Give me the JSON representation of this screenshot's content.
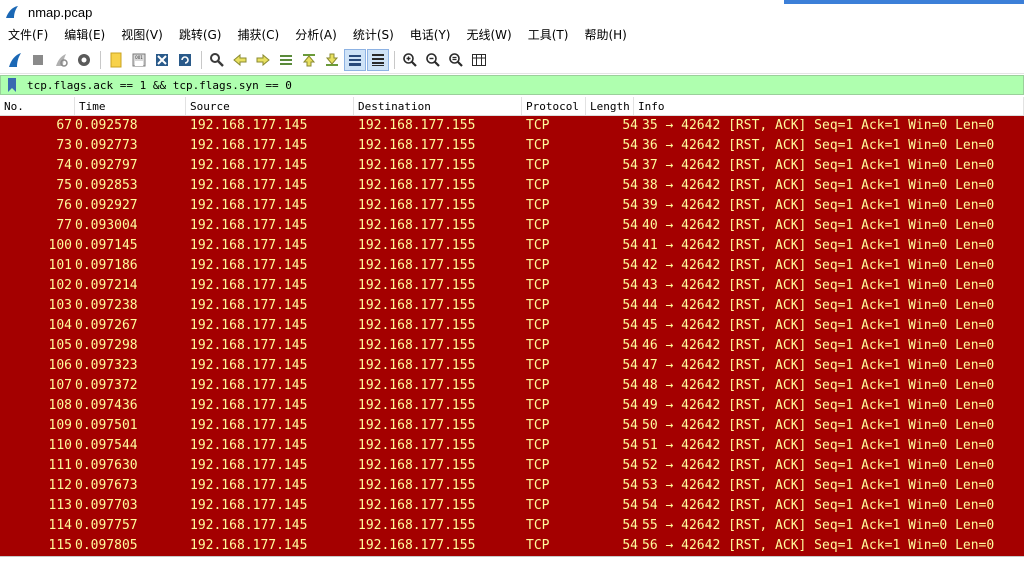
{
  "window": {
    "title": "nmap.pcap",
    "accent_color": "#3c7fd8"
  },
  "menu": [
    {
      "label": "文件(F)"
    },
    {
      "label": "编辑(E)"
    },
    {
      "label": "视图(V)"
    },
    {
      "label": "跳转(G)"
    },
    {
      "label": "捕获(C)"
    },
    {
      "label": "分析(A)"
    },
    {
      "label": "统计(S)"
    },
    {
      "label": "电话(Y)"
    },
    {
      "label": "无线(W)"
    },
    {
      "label": "工具(T)"
    },
    {
      "label": "帮助(H)"
    }
  ],
  "toolbar": {
    "icons": [
      "shark-fin-icon",
      "stop-icon",
      "restart-icon",
      "options-gear-icon",
      "open-file-icon",
      "save-file-icon",
      "close-file-icon",
      "reload-icon",
      "find-icon",
      "go-back-icon",
      "go-forward-icon",
      "go-to-packet-icon",
      "first-packet-icon",
      "last-packet-icon",
      "autoscroll-icon",
      "colorize-icon",
      "zoom-in-icon",
      "zoom-out-icon",
      "zoom-normal-icon",
      "resize-columns-icon"
    ]
  },
  "filter": {
    "value": "tcp.flags.ack == 1 && tcp.flags.syn == 0",
    "bg_color": "#afffaf"
  },
  "columns": {
    "no": "No.",
    "time": "Time",
    "source": "Source",
    "destination": "Destination",
    "protocol": "Protocol",
    "length": "Length",
    "info": "Info"
  },
  "row_colors": {
    "background": "#a40000",
    "foreground": "#fffc9c"
  },
  "packets": [
    {
      "no": "67",
      "time": "0.092578",
      "src": "192.168.177.145",
      "dst": "192.168.177.155",
      "proto": "TCP",
      "len": "54",
      "info": "35 → 42642 [RST, ACK] Seq=1 Ack=1 Win=0 Len=0"
    },
    {
      "no": "73",
      "time": "0.092773",
      "src": "192.168.177.145",
      "dst": "192.168.177.155",
      "proto": "TCP",
      "len": "54",
      "info": "36 → 42642 [RST, ACK] Seq=1 Ack=1 Win=0 Len=0"
    },
    {
      "no": "74",
      "time": "0.092797",
      "src": "192.168.177.145",
      "dst": "192.168.177.155",
      "proto": "TCP",
      "len": "54",
      "info": "37 → 42642 [RST, ACK] Seq=1 Ack=1 Win=0 Len=0"
    },
    {
      "no": "75",
      "time": "0.092853",
      "src": "192.168.177.145",
      "dst": "192.168.177.155",
      "proto": "TCP",
      "len": "54",
      "info": "38 → 42642 [RST, ACK] Seq=1 Ack=1 Win=0 Len=0"
    },
    {
      "no": "76",
      "time": "0.092927",
      "src": "192.168.177.145",
      "dst": "192.168.177.155",
      "proto": "TCP",
      "len": "54",
      "info": "39 → 42642 [RST, ACK] Seq=1 Ack=1 Win=0 Len=0"
    },
    {
      "no": "77",
      "time": "0.093004",
      "src": "192.168.177.145",
      "dst": "192.168.177.155",
      "proto": "TCP",
      "len": "54",
      "info": "40 → 42642 [RST, ACK] Seq=1 Ack=1 Win=0 Len=0"
    },
    {
      "no": "100",
      "time": "0.097145",
      "src": "192.168.177.145",
      "dst": "192.168.177.155",
      "proto": "TCP",
      "len": "54",
      "info": "41 → 42642 [RST, ACK] Seq=1 Ack=1 Win=0 Len=0"
    },
    {
      "no": "101",
      "time": "0.097186",
      "src": "192.168.177.145",
      "dst": "192.168.177.155",
      "proto": "TCP",
      "len": "54",
      "info": "42 → 42642 [RST, ACK] Seq=1 Ack=1 Win=0 Len=0"
    },
    {
      "no": "102",
      "time": "0.097214",
      "src": "192.168.177.145",
      "dst": "192.168.177.155",
      "proto": "TCP",
      "len": "54",
      "info": "43 → 42642 [RST, ACK] Seq=1 Ack=1 Win=0 Len=0"
    },
    {
      "no": "103",
      "time": "0.097238",
      "src": "192.168.177.145",
      "dst": "192.168.177.155",
      "proto": "TCP",
      "len": "54",
      "info": "44 → 42642 [RST, ACK] Seq=1 Ack=1 Win=0 Len=0"
    },
    {
      "no": "104",
      "time": "0.097267",
      "src": "192.168.177.145",
      "dst": "192.168.177.155",
      "proto": "TCP",
      "len": "54",
      "info": "45 → 42642 [RST, ACK] Seq=1 Ack=1 Win=0 Len=0"
    },
    {
      "no": "105",
      "time": "0.097298",
      "src": "192.168.177.145",
      "dst": "192.168.177.155",
      "proto": "TCP",
      "len": "54",
      "info": "46 → 42642 [RST, ACK] Seq=1 Ack=1 Win=0 Len=0"
    },
    {
      "no": "106",
      "time": "0.097323",
      "src": "192.168.177.145",
      "dst": "192.168.177.155",
      "proto": "TCP",
      "len": "54",
      "info": "47 → 42642 [RST, ACK] Seq=1 Ack=1 Win=0 Len=0"
    },
    {
      "no": "107",
      "time": "0.097372",
      "src": "192.168.177.145",
      "dst": "192.168.177.155",
      "proto": "TCP",
      "len": "54",
      "info": "48 → 42642 [RST, ACK] Seq=1 Ack=1 Win=0 Len=0"
    },
    {
      "no": "108",
      "time": "0.097436",
      "src": "192.168.177.145",
      "dst": "192.168.177.155",
      "proto": "TCP",
      "len": "54",
      "info": "49 → 42642 [RST, ACK] Seq=1 Ack=1 Win=0 Len=0"
    },
    {
      "no": "109",
      "time": "0.097501",
      "src": "192.168.177.145",
      "dst": "192.168.177.155",
      "proto": "TCP",
      "len": "54",
      "info": "50 → 42642 [RST, ACK] Seq=1 Ack=1 Win=0 Len=0"
    },
    {
      "no": "110",
      "time": "0.097544",
      "src": "192.168.177.145",
      "dst": "192.168.177.155",
      "proto": "TCP",
      "len": "54",
      "info": "51 → 42642 [RST, ACK] Seq=1 Ack=1 Win=0 Len=0"
    },
    {
      "no": "111",
      "time": "0.097630",
      "src": "192.168.177.145",
      "dst": "192.168.177.155",
      "proto": "TCP",
      "len": "54",
      "info": "52 → 42642 [RST, ACK] Seq=1 Ack=1 Win=0 Len=0"
    },
    {
      "no": "112",
      "time": "0.097673",
      "src": "192.168.177.145",
      "dst": "192.168.177.155",
      "proto": "TCP",
      "len": "54",
      "info": "53 → 42642 [RST, ACK] Seq=1 Ack=1 Win=0 Len=0"
    },
    {
      "no": "113",
      "time": "0.097703",
      "src": "192.168.177.145",
      "dst": "192.168.177.155",
      "proto": "TCP",
      "len": "54",
      "info": "54 → 42642 [RST, ACK] Seq=1 Ack=1 Win=0 Len=0"
    },
    {
      "no": "114",
      "time": "0.097757",
      "src": "192.168.177.145",
      "dst": "192.168.177.155",
      "proto": "TCP",
      "len": "54",
      "info": "55 → 42642 [RST, ACK] Seq=1 Ack=1 Win=0 Len=0"
    },
    {
      "no": "115",
      "time": "0.097805",
      "src": "192.168.177.145",
      "dst": "192.168.177.155",
      "proto": "TCP",
      "len": "54",
      "info": "56 → 42642 [RST, ACK] Seq=1 Ack=1 Win=0 Len=0"
    }
  ]
}
